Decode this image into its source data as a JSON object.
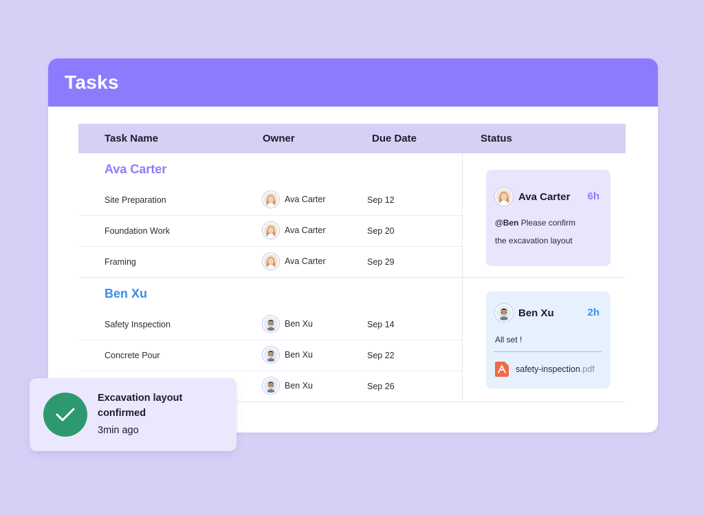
{
  "header": {
    "title": "Tasks"
  },
  "table": {
    "columns": [
      "Task Name",
      "Owner",
      "Due Date",
      "Status"
    ],
    "groups": [
      {
        "name": "Ava Carter",
        "color": "#8b7cfe",
        "rows": [
          {
            "task": "Site Preparation",
            "owner": "Ava Carter",
            "due": "Sep 12"
          },
          {
            "task": "Foundation Work",
            "owner": "Ava Carter",
            "due": "Sep 20"
          },
          {
            "task": "Framing",
            "owner": "Ava Carter",
            "due": "Sep 29"
          }
        ],
        "comment": {
          "author": "Ava Carter",
          "time": "6h",
          "mention": "@Ben",
          "text_line1": "Please confirm",
          "text_line2": "the excavation layout"
        }
      },
      {
        "name": "Ben Xu",
        "color": "#3b8fe6",
        "rows": [
          {
            "task": "Safety Inspection",
            "owner": "Ben Xu",
            "due": "Sep 14"
          },
          {
            "task": "Concrete Pour",
            "owner": "Ben Xu",
            "due": "Sep 22"
          },
          {
            "task": "",
            "owner": "Ben Xu",
            "due": "Sep 26"
          }
        ],
        "comment": {
          "author": "Ben Xu",
          "time": "2h",
          "text": "All set !",
          "attachment_name": "safety-inspection",
          "attachment_ext": ".pdf"
        }
      }
    ]
  },
  "toast": {
    "title": "Excavation layout confirmed",
    "time": "3min ago"
  },
  "colors": {
    "accent": "#8b7cfe",
    "background": "#d6cff6",
    "success": "#2e9870",
    "blue": "#3b8fe6",
    "pdf": "#f06a4a"
  }
}
